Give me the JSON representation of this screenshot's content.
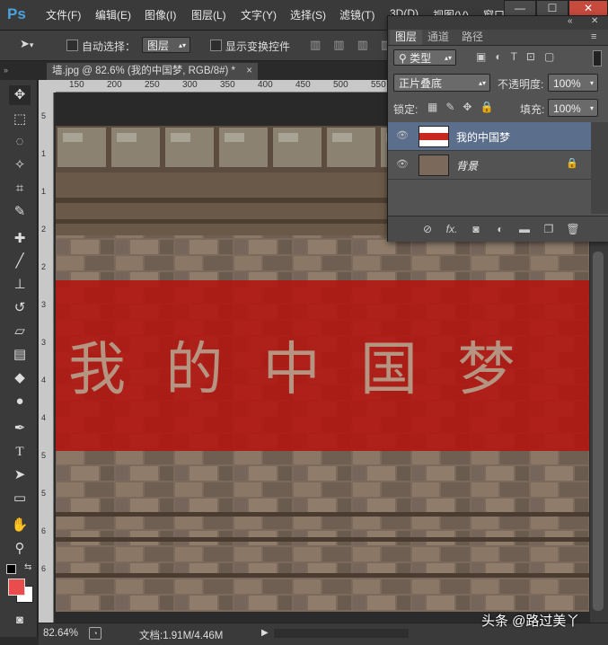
{
  "app": {
    "logo": "Ps"
  },
  "menu": [
    "文件(F)",
    "编辑(E)",
    "图像(I)",
    "图层(L)",
    "文字(Y)",
    "选择(S)",
    "滤镜(T)",
    "3D(D)",
    "视图(V)",
    "窗口"
  ],
  "window_buttons": [
    "—",
    "☐",
    "✕"
  ],
  "options": {
    "auto_select_label": "自动选择：",
    "auto_select_value": "图层",
    "show_transform_label": "显示变换控件"
  },
  "document": {
    "tab_title": "墙.jpg @ 82.6% (我的中国梦, RGB/8#) *",
    "tab_close": "×"
  },
  "ruler": {
    "h_ticks": [
      "150",
      "200",
      "250",
      "300",
      "350",
      "400",
      "450",
      "500",
      "550"
    ],
    "v_ticks": [
      "5",
      "1",
      "1",
      "2",
      "2",
      "3",
      "3",
      "4",
      "4",
      "5",
      "5",
      "6",
      "6"
    ]
  },
  "canvas": {
    "text": "我 的 中 国 梦"
  },
  "status": {
    "zoom": "82.64%",
    "doc_info": "文档:1.91M/4.46M"
  },
  "layers_panel": {
    "tabs": [
      "图层",
      "通道",
      "路径"
    ],
    "filter_kind": "类型",
    "blend_mode": "正片叠底",
    "opacity_label": "不透明度:",
    "opacity_value": "100%",
    "lock_label": "锁定:",
    "fill_label": "填充:",
    "fill_value": "100%",
    "layers": [
      {
        "name": "我的中国梦",
        "selected": true
      },
      {
        "name": "背景",
        "locked": true
      }
    ],
    "footer_icons": [
      "link-icon",
      "fx-icon",
      "mask-icon",
      "adjustment-icon",
      "group-icon",
      "new-layer-icon",
      "trash-icon"
    ],
    "fx_label": "fx."
  },
  "watermark": "头条 @路过美丫",
  "colors": {
    "accent": "#4aa3df",
    "red_band": "#b3150f",
    "foreground": "#e84c4c",
    "background": "#ffffff",
    "selected_layer": "#5b6f8c"
  }
}
